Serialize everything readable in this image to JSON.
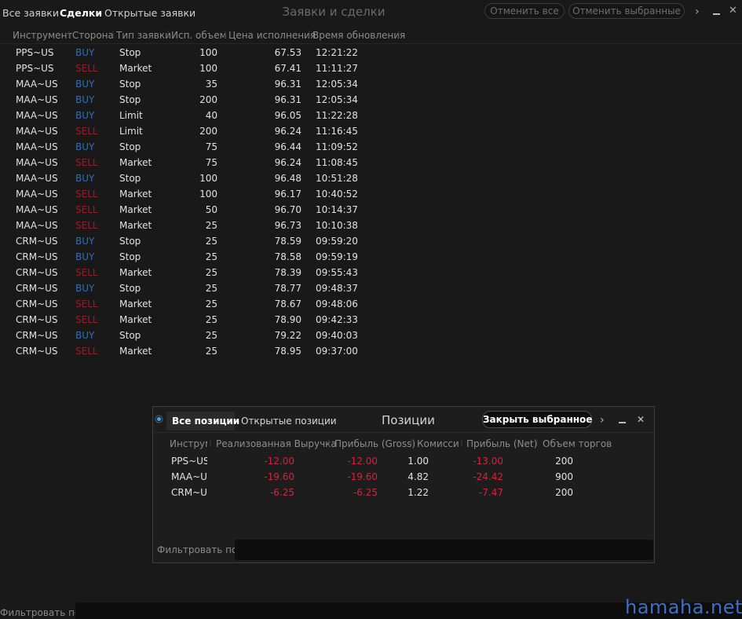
{
  "top_tabs": {
    "all_orders": "Все заявки",
    "trades": "Сделки",
    "open_orders": "Открытые заявки"
  },
  "window_title": "Заявки и сделки",
  "buttons": {
    "cancel_all": "Отменить все",
    "cancel_selected": "Отменить выбранные"
  },
  "columns": [
    "Инструмент",
    "Сторона",
    "Тип заявки",
    "Исп. объем",
    "Цена исполнения",
    "Время обновления"
  ],
  "trades": [
    {
      "instrument": "PPS~US",
      "side": "BUY",
      "type": "Stop",
      "volume": "100",
      "price": "67.53",
      "time": "12:21:22"
    },
    {
      "instrument": "PPS~US",
      "side": "SELL",
      "type": "Market",
      "volume": "100",
      "price": "67.41",
      "time": "11:11:27"
    },
    {
      "instrument": "MAA~US",
      "side": "BUY",
      "type": "Stop",
      "volume": "35",
      "price": "96.31",
      "time": "12:05:34"
    },
    {
      "instrument": "MAA~US",
      "side": "BUY",
      "type": "Stop",
      "volume": "200",
      "price": "96.31",
      "time": "12:05:34"
    },
    {
      "instrument": "MAA~US",
      "side": "BUY",
      "type": "Limit",
      "volume": "40",
      "price": "96.05",
      "time": "11:22:28"
    },
    {
      "instrument": "MAA~US",
      "side": "SELL",
      "type": "Limit",
      "volume": "200",
      "price": "96.24",
      "time": "11:16:45"
    },
    {
      "instrument": "MAA~US",
      "side": "BUY",
      "type": "Stop",
      "volume": "75",
      "price": "96.44",
      "time": "11:09:52"
    },
    {
      "instrument": "MAA~US",
      "side": "SELL",
      "type": "Market",
      "volume": "75",
      "price": "96.24",
      "time": "11:08:45"
    },
    {
      "instrument": "MAA~US",
      "side": "BUY",
      "type": "Stop",
      "volume": "100",
      "price": "96.48",
      "time": "10:51:28"
    },
    {
      "instrument": "MAA~US",
      "side": "SELL",
      "type": "Market",
      "volume": "100",
      "price": "96.17",
      "time": "10:40:52"
    },
    {
      "instrument": "MAA~US",
      "side": "SELL",
      "type": "Market",
      "volume": "50",
      "price": "96.70",
      "time": "10:14:37"
    },
    {
      "instrument": "MAA~US",
      "side": "SELL",
      "type": "Market",
      "volume": "25",
      "price": "96.73",
      "time": "10:10:38"
    },
    {
      "instrument": "CRM~US",
      "side": "BUY",
      "type": "Stop",
      "volume": "25",
      "price": "78.59",
      "time": "09:59:20"
    },
    {
      "instrument": "CRM~US",
      "side": "BUY",
      "type": "Stop",
      "volume": "25",
      "price": "78.58",
      "time": "09:59:19"
    },
    {
      "instrument": "CRM~US",
      "side": "SELL",
      "type": "Market",
      "volume": "25",
      "price": "78.39",
      "time": "09:55:43"
    },
    {
      "instrument": "CRM~US",
      "side": "BUY",
      "type": "Stop",
      "volume": "25",
      "price": "78.77",
      "time": "09:48:37"
    },
    {
      "instrument": "CRM~US",
      "side": "SELL",
      "type": "Market",
      "volume": "25",
      "price": "78.67",
      "time": "09:48:06"
    },
    {
      "instrument": "CRM~US",
      "side": "SELL",
      "type": "Market",
      "volume": "25",
      "price": "78.90",
      "time": "09:42:33"
    },
    {
      "instrument": "CRM~US",
      "side": "BUY",
      "type": "Stop",
      "volume": "25",
      "price": "79.22",
      "time": "09:40:03"
    },
    {
      "instrument": "CRM~US",
      "side": "SELL",
      "type": "Market",
      "volume": "25",
      "price": "78.95",
      "time": "09:37:00"
    }
  ],
  "filter_label": "Фильтровать по",
  "positions": {
    "tabs": {
      "all": "Все позиции",
      "open": "Открытые позиции"
    },
    "title": "Позиции",
    "close_selected": "Закрыть выбранное",
    "columns": [
      "Инструм",
      "Реализованная Выручка",
      "Прибыль (Gross)",
      "Комисси",
      "Прибыль (Net)",
      "Объем торгов"
    ],
    "rows": [
      {
        "instrument": "PPS~US",
        "realized": "-12.00",
        "gross": "-12.00",
        "commission": "1.00",
        "net": "-13.00",
        "volume": "200"
      },
      {
        "instrument": "MAA~US",
        "realized": "-19.60",
        "gross": "-19.60",
        "commission": "4.82",
        "net": "-24.42",
        "volume": "900"
      },
      {
        "instrument": "CRM~US",
        "realized": "-6.25",
        "gross": "-6.25",
        "commission": "1.22",
        "net": "-7.47",
        "volume": "200"
      }
    ],
    "filter_label": "Фильтровать по"
  },
  "icons": {
    "chevron": "chevron-right-icon",
    "minimize": "minimize-icon",
    "close": "close-icon",
    "radio": "radio-icon"
  },
  "colors": {
    "buy": "#2d6fb8",
    "sell": "#a2172a",
    "negative": "#d0253d",
    "watermark": "#3f6ec4"
  },
  "watermark": "hamaha.net"
}
